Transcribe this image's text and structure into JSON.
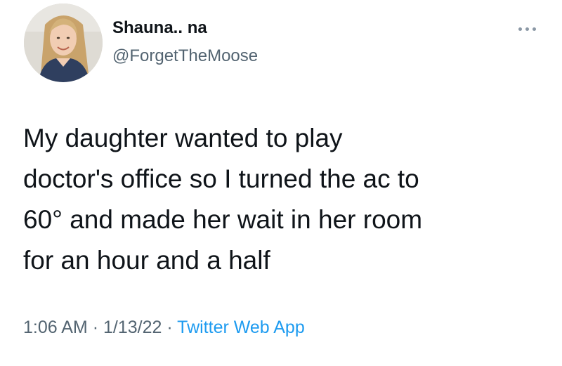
{
  "author": {
    "display_name": "Shauna.. na",
    "handle": "@ForgetTheMoose",
    "avatar_icon": "profile-photo"
  },
  "more_icon": "more-options-icon",
  "tweet": {
    "text_lines": [
      "My daughter wanted to play",
      "doctor's office so I turned the ac to",
      "60° and made her wait in her room",
      "for an hour and a half"
    ]
  },
  "meta": {
    "time": "1:06 AM",
    "separator": "·",
    "date": "1/13/22",
    "source": "Twitter Web App"
  },
  "colors": {
    "text": "#0f1419",
    "secondary": "#536471",
    "link": "#1d9bf0"
  }
}
